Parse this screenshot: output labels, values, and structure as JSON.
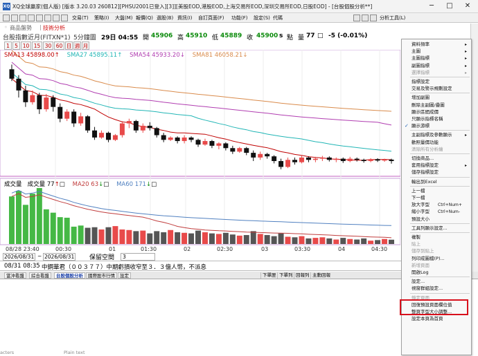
{
  "window": {
    "title": "XQ全球贏家(個人版) [版本 3.20.03 260812][PHSU2001已登入][3]][美股EOD,港股EOD,上海交易所EOD,深圳交易所EOD,日股EOD] - [台股個股分析**]",
    "icon_text": "XQ",
    "minimize": "─",
    "maximize": "□",
    "close": "✕"
  },
  "menubar": {
    "items": [
      "交易(T)",
      "策略(I)",
      "大盤(M)",
      "報價(Q)",
      "選股(B)",
      "資訊(I)",
      "自訂頁面(F)",
      "功能(F)",
      "設定(S)",
      "代碼"
    ],
    "right_label": "分析工具(L)"
  },
  "tabs": {
    "goods": "商品盤勢",
    "tech": "技術分析"
  },
  "quote": {
    "name": "台股指數近月(FITXN*1)",
    "period": "5分鐘圖",
    "date": "29日 04:55",
    "open_label": "開",
    "open": "45906",
    "high_label": "高",
    "high": "45910",
    "low_label": "低",
    "low": "45889",
    "close_label": "收",
    "close": "45900",
    "s": "s",
    "point_label": "點",
    "vol_label": "量",
    "vol": "77",
    "box": "□",
    "change": "-5 (-0.01%)"
  },
  "intervals": [
    "1",
    "5",
    "10",
    "15",
    "30",
    "60",
    "日",
    "週",
    "月"
  ],
  "legend_price": [
    {
      "label": "SMA13 45898.00",
      "arrow": "↑",
      "color": "#c00000"
    },
    {
      "label": "SMA27 45895.11",
      "arrow": "↑",
      "color": "#20b5b5"
    },
    {
      "label": "SMA54 45933.20",
      "arrow": "↓",
      "color": "#b03cb0"
    },
    {
      "label": "SMA81 46058.21",
      "arrow": "↓",
      "color": "#d98a4a"
    }
  ],
  "legend_volume": {
    "vol_title": "成交量",
    "vol_label": "成交量 77",
    "vol_arrow": "↑",
    "vol_box": "□",
    "ma20": "MA20 63",
    "ma20_arrow": "↓",
    "ma20_box": "□",
    "ma60": "MA60 171",
    "ma60_arrow": "↓",
    "ma60_box": "□"
  },
  "colors": {
    "up": "#e84a4a",
    "down": "#111111",
    "volume_up": "#45b845",
    "sma13": "#c00000",
    "sma27": "#20b5b5",
    "sma54": "#b03cb0",
    "sma81": "#d98a4a",
    "ma20": "#c03c3c",
    "ma60": "#5080c0",
    "highlight": "#d8101c"
  },
  "xaxis": {
    "ticks": [
      "08/28 23:40",
      "00:30",
      "01",
      "01:30",
      "02",
      "02:30",
      "03",
      "03:30",
      "04",
      "04:30"
    ]
  },
  "range_bar": {
    "start": "2026/08/31",
    "end": "2026/08/31",
    "keep_label": "保留空間",
    "keep_value": "3"
  },
  "news": {
    "time": "08/31 08:35",
    "text": "中鋼華君（００３７７）中期虧損收窄至３．３億人幣，不派息"
  },
  "bottom_tabs": [
    "當沖看盤",
    "綜合看盤",
    "台股個股分析",
    "國際股市行情",
    "設定"
  ],
  "bottom_right_tabs": [
    "下單匣",
    "下單列",
    "回報列",
    "主動回報"
  ],
  "status": {
    "a": "acters",
    "b": "Plain text"
  },
  "context_menu": [
    {
      "label": "資料頻率",
      "arrow": "▸",
      "enabled": true
    },
    {
      "label": "主圖",
      "arrow": "▸",
      "enabled": true
    },
    {
      "label": "主圖指標",
      "arrow": "▸",
      "enabled": true
    },
    {
      "label": "副圖指標",
      "arrow": "▸",
      "enabled": true
    },
    {
      "label": "選擇指標",
      "arrow": "▸",
      "enabled": false
    },
    {
      "sep": true
    },
    {
      "label": "指標設定",
      "enabled": true
    },
    {
      "label": "交易及警示規劃設定",
      "enabled": true
    },
    {
      "sep": true
    },
    {
      "label": "增加副圖",
      "enabled": true
    },
    {
      "label": "刪除主副圖/疊圖",
      "enabled": true
    },
    {
      "label": "顯示區間成價",
      "enabled": true
    },
    {
      "label": "只顯示指標名稱",
      "enabled": true
    },
    {
      "label": "顯示游標",
      "check": "✓",
      "enabled": true
    },
    {
      "sep": true
    },
    {
      "label": "主副指標及參數顯示",
      "arrow": "▸",
      "enabled": true
    },
    {
      "label": "歡照量價功能",
      "enabled": true
    },
    {
      "label": "清除所有分析繪",
      "enabled": false
    },
    {
      "sep": true
    },
    {
      "label": "切換商品...",
      "enabled": true
    },
    {
      "label": "套用指標設定",
      "arrow": "▸",
      "enabled": true
    },
    {
      "label": "儲存指標設定",
      "enabled": true
    },
    {
      "sep": true
    },
    {
      "label": "輸出到Excel",
      "enabled": true
    },
    {
      "sep": true
    },
    {
      "label": "上一檔",
      "enabled": true
    },
    {
      "label": "下一檔",
      "enabled": true
    },
    {
      "label": "放大字型",
      "shortcut": "Ctrl+Num+",
      "enabled": true
    },
    {
      "label": "縮小字型",
      "shortcut": "Ctrl+Num-",
      "enabled": true
    },
    {
      "label": "預設大小",
      "enabled": true
    },
    {
      "sep": true
    },
    {
      "label": "工具列顯示設定...",
      "enabled": true
    },
    {
      "sep": true
    },
    {
      "label": "複製",
      "enabled": true
    },
    {
      "label": "貼上",
      "enabled": false
    },
    {
      "label": "儲存到貼上",
      "enabled": false
    },
    {
      "label": "列印成圖檔(P)...",
      "enabled": true
    },
    {
      "label": "新增頁面",
      "enabled": false
    },
    {
      "label": "開啟Log",
      "enabled": true
    },
    {
      "sep": true
    },
    {
      "label": "設定...",
      "enabled": true,
      "highlighted": true
    },
    {
      "label": "視窗群組設定...",
      "enabled": true
    },
    {
      "sep": true
    },
    {
      "label": "鎖定頁面",
      "enabled": false
    },
    {
      "label": "回復預設頁面欄位值",
      "enabled": true
    },
    {
      "label": "整頁字型大小調整...",
      "enabled": true
    },
    {
      "label": "設定本頁為首頁",
      "enabled": true
    }
  ],
  "chart_data": [
    {
      "type": "candlestick",
      "title": "台股指數近月(FITXN*1)",
      "x_ticks": [
        "08/28 23:40",
        "00:30",
        "01",
        "01:30",
        "02",
        "02:30",
        "03",
        "03:30",
        "04",
        "04:30"
      ],
      "candles": [
        {
          "o": 46290,
          "c": 46250,
          "h": 46310,
          "l": 46240
        },
        {
          "o": 46250,
          "c": 46200,
          "h": 46265,
          "l": 46170
        },
        {
          "o": 46200,
          "c": 46150,
          "h": 46220,
          "l": 46130
        },
        {
          "o": 46150,
          "c": 46180,
          "h": 46200,
          "l": 46140
        },
        {
          "o": 46180,
          "c": 46120,
          "h": 46190,
          "l": 46100
        },
        {
          "o": 46120,
          "c": 46170,
          "h": 46185,
          "l": 46110
        },
        {
          "o": 46170,
          "c": 46130,
          "h": 46180,
          "l": 46110
        },
        {
          "o": 46130,
          "c": 46080,
          "h": 46145,
          "l": 46065
        },
        {
          "o": 46080,
          "c": 46110,
          "h": 46120,
          "l": 46070
        },
        {
          "o": 46110,
          "c": 46060,
          "h": 46120,
          "l": 46045
        },
        {
          "o": 46060,
          "c": 46090,
          "h": 46105,
          "l": 46050
        },
        {
          "o": 46090,
          "c": 46030,
          "h": 46095,
          "l": 46020
        },
        {
          "o": 46030,
          "c": 46000,
          "h": 46045,
          "l": 45990
        },
        {
          "o": 46000,
          "c": 46020,
          "h": 46030,
          "l": 45995
        },
        {
          "o": 46020,
          "c": 45990,
          "h": 46025,
          "l": 45980
        },
        {
          "o": 45990,
          "c": 46010,
          "h": 46015,
          "l": 45985
        },
        {
          "o": 46010,
          "c": 46060,
          "h": 46070,
          "l": 46000
        },
        {
          "o": 46060,
          "c": 46070,
          "h": 46080,
          "l": 46040
        },
        {
          "o": 46070,
          "c": 46030,
          "h": 46075,
          "l": 46020
        },
        {
          "o": 46030,
          "c": 46050,
          "h": 46060,
          "l": 46020
        },
        {
          "o": 46050,
          "c": 46040,
          "h": 46065,
          "l": 46030
        },
        {
          "o": 46040,
          "c": 46010,
          "h": 46045,
          "l": 46000
        },
        {
          "o": 46010,
          "c": 45990,
          "h": 46020,
          "l": 45980
        },
        {
          "o": 45990,
          "c": 46000,
          "h": 46005,
          "l": 45985
        },
        {
          "o": 46000,
          "c": 45985,
          "h": 46005,
          "l": 45975
        },
        {
          "o": 45985,
          "c": 46000,
          "h": 46010,
          "l": 45975
        },
        {
          "o": 46000,
          "c": 45990,
          "h": 46005,
          "l": 45980
        },
        {
          "o": 45990,
          "c": 45970,
          "h": 45995,
          "l": 45960
        },
        {
          "o": 45970,
          "c": 45985,
          "h": 45995,
          "l": 45965
        },
        {
          "o": 45985,
          "c": 45965,
          "h": 45990,
          "l": 45955
        },
        {
          "o": 45965,
          "c": 45975,
          "h": 45980,
          "l": 45950
        },
        {
          "o": 45975,
          "c": 45955,
          "h": 45980,
          "l": 45945
        },
        {
          "o": 45955,
          "c": 45940,
          "h": 45965,
          "l": 45930
        },
        {
          "o": 45940,
          "c": 45955,
          "h": 45960,
          "l": 45935
        },
        {
          "o": 45955,
          "c": 45935,
          "h": 45960,
          "l": 45925
        },
        {
          "o": 45935,
          "c": 45915,
          "h": 45945,
          "l": 45900
        },
        {
          "o": 45915,
          "c": 45930,
          "h": 45940,
          "l": 45905
        },
        {
          "o": 45930,
          "c": 45920,
          "h": 45935,
          "l": 45910
        },
        {
          "o": 45920,
          "c": 45900,
          "h": 45925,
          "l": 45890
        },
        {
          "o": 45900,
          "c": 45875,
          "h": 45910,
          "l": 45865
        },
        {
          "o": 45875,
          "c": 45905,
          "h": 45915,
          "l": 45870
        },
        {
          "o": 45905,
          "c": 45895,
          "h": 45915,
          "l": 45885
        },
        {
          "o": 45895,
          "c": 45915,
          "h": 45925,
          "l": 45890
        },
        {
          "o": 45915,
          "c": 45905,
          "h": 45920,
          "l": 45895
        },
        {
          "o": 45905,
          "c": 45910,
          "h": 45918,
          "l": 45895
        },
        {
          "o": 45910,
          "c": 45915,
          "h": 45922,
          "l": 45900
        },
        {
          "o": 45915,
          "c": 45905,
          "h": 45920,
          "l": 45898
        },
        {
          "o": 45905,
          "c": 45910,
          "h": 45915,
          "l": 45895
        },
        {
          "o": 45910,
          "c": 45900,
          "h": 45915,
          "l": 45892
        },
        {
          "o": 45900,
          "c": 45910,
          "h": 45918,
          "l": 45895
        },
        {
          "o": 45910,
          "c": 45905,
          "h": 45915,
          "l": 45898
        },
        {
          "o": 45905,
          "c": 45900,
          "h": 45910,
          "l": 45893
        },
        {
          "o": 45900,
          "c": 45908,
          "h": 45912,
          "l": 45895
        },
        {
          "o": 45908,
          "c": 45902,
          "h": 45912,
          "l": 45896
        },
        {
          "o": 45902,
          "c": 45906,
          "h": 45910,
          "l": 45897
        },
        {
          "o": 45906,
          "c": 45900,
          "h": 45910,
          "l": 45889
        }
      ],
      "ylim": [
        45850,
        46320
      ]
    },
    {
      "type": "bar",
      "title": "成交量",
      "values": [
        850,
        950,
        700,
        900,
        1000,
        620,
        560,
        480,
        470,
        310,
        330,
        290,
        300,
        260,
        300,
        320,
        260,
        250,
        230,
        240,
        190,
        230,
        210,
        250,
        210,
        200,
        190,
        240,
        210,
        190,
        180,
        200,
        170,
        150,
        160,
        230,
        180,
        160,
        140,
        190,
        130,
        120,
        140,
        100,
        110,
        120,
        100,
        80,
        110,
        90,
        80,
        100,
        60,
        70,
        90,
        77
      ],
      "ylim": [
        0,
        1050
      ]
    }
  ]
}
